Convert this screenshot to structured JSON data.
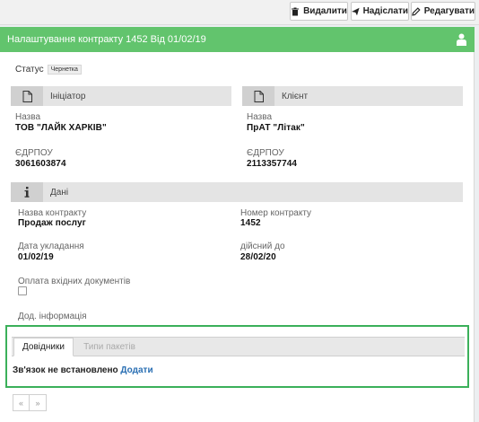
{
  "toolbar": {
    "delete_label": "Видалити",
    "send_label": "Надіслати",
    "edit_label": "Редагувати"
  },
  "header": {
    "title": "Налаштування контракту 1452 Від 01/02/19"
  },
  "status": {
    "label": "Статус",
    "badge": "Чернетка"
  },
  "initiator": {
    "section_title": "Ініціатор",
    "name_label": "Назва",
    "name_value": "ТОВ \"ЛАЙК ХАРКІВ\"",
    "edrpou_label": "ЄДРПОУ",
    "edrpou_value": "3061603874"
  },
  "client": {
    "section_title": "Клієнт",
    "name_label": "Назва",
    "name_value": "ПрАТ \"Літак\"",
    "edrpou_label": "ЄДРПОУ",
    "edrpou_value": "2113357744"
  },
  "data_section": {
    "section_title": "Дані",
    "contract_name_label": "Назва контракту",
    "contract_name_value": "Продаж послуг",
    "contract_number_label": "Номер контракту",
    "contract_number_value": "1452",
    "sign_date_label": "Дата укладання",
    "sign_date_value": "01/02/19",
    "valid_until_label": "дійсний до",
    "valid_until_value": "28/02/20",
    "payment_label": "Оплата вхідних документів",
    "extra_label": "Дод. інформація"
  },
  "tabs": {
    "active": "Довідники",
    "inactive": "Типи пакетів"
  },
  "relation": {
    "text": "Зв'язок не встановлено",
    "add_link": "Додати"
  },
  "pager": {
    "prev": "«",
    "next": "»"
  },
  "colors": {
    "header_green": "#62c46d",
    "highlight_green": "#3bb05a",
    "link_blue": "#2a6fb3"
  },
  "icons": [
    "trash-icon",
    "send-icon",
    "edit-icon",
    "user-icon",
    "document-icon",
    "info-icon"
  ]
}
